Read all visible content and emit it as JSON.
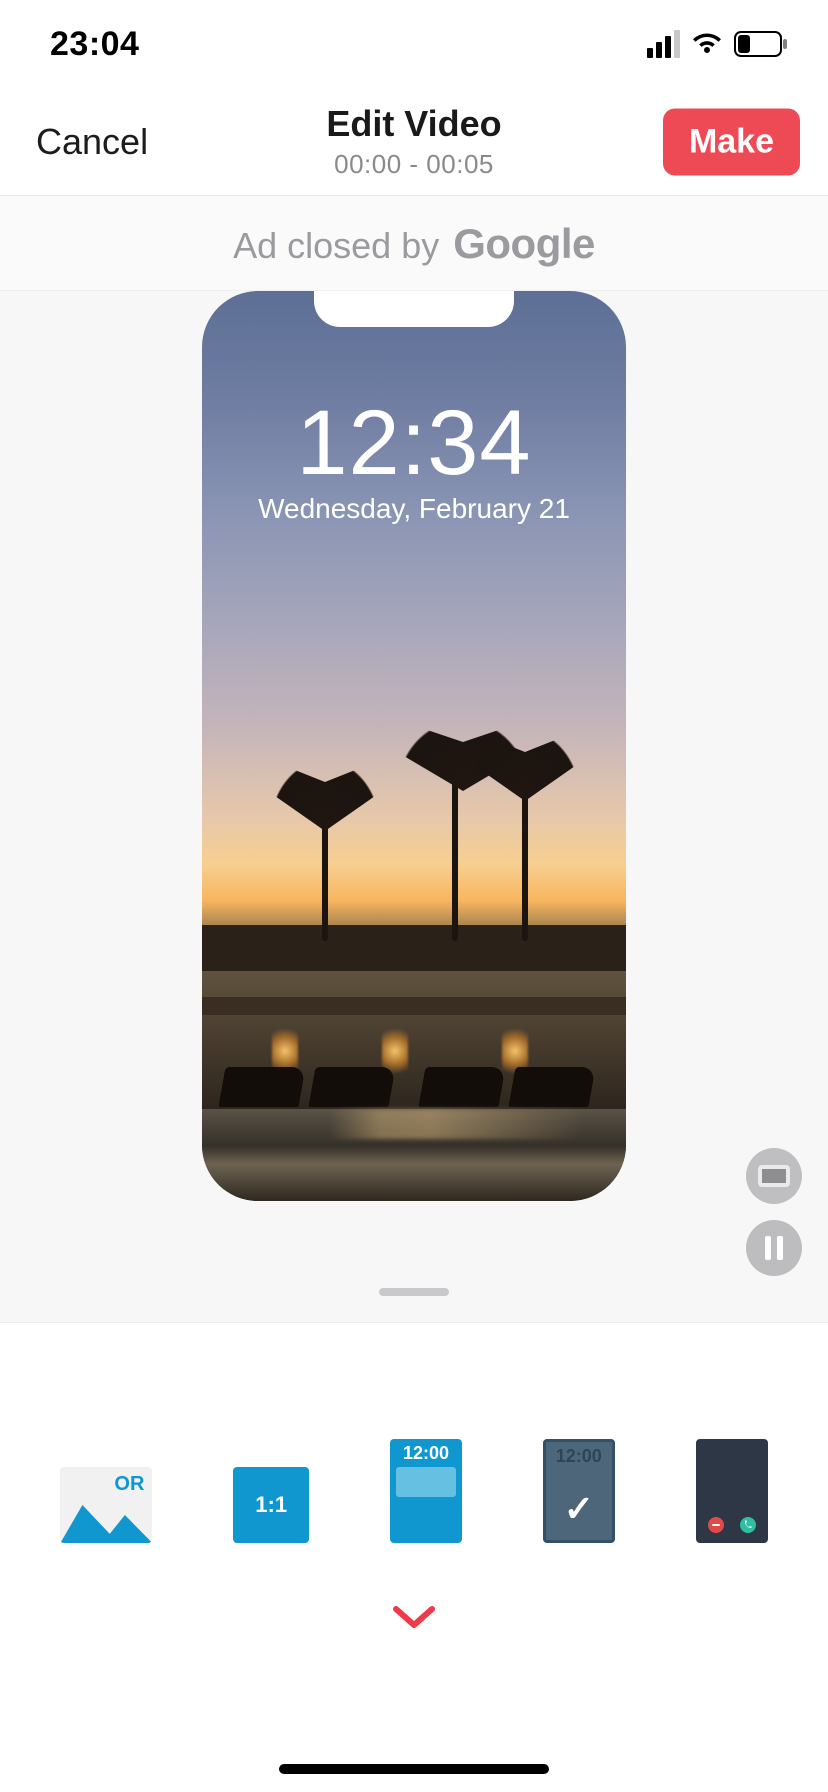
{
  "status": {
    "clock": "23:04"
  },
  "nav": {
    "cancel": "Cancel",
    "title": "Edit Video",
    "range": "00:00 - 00:05",
    "make": "Make"
  },
  "ad": {
    "text": "Ad closed by",
    "brand": "Google"
  },
  "lockscreen": {
    "time": "12:34",
    "date": "Wednesday, February 21"
  },
  "options": {
    "original_label": "OR",
    "square_label": "1:1",
    "lock1_time": "12:00",
    "lock2_time": "12:00"
  }
}
